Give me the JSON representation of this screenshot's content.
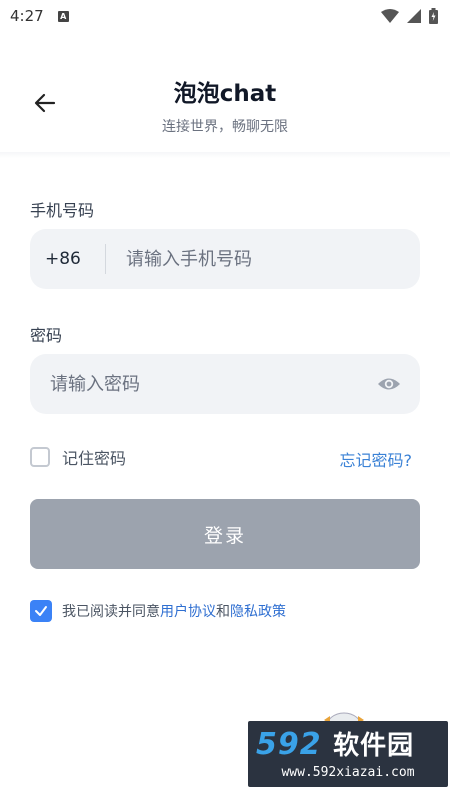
{
  "status_bar": {
    "time": "4:27",
    "notification_icon": "A"
  },
  "header": {
    "title": "泡泡chat",
    "subtitle": "连接世界，畅聊无限"
  },
  "phone": {
    "label": "手机号码",
    "country_code": "+86",
    "placeholder": "请输入手机号码",
    "value": ""
  },
  "password": {
    "label": "密码",
    "placeholder": "请输入密码",
    "value": ""
  },
  "remember": {
    "label": "记住密码",
    "checked": false
  },
  "forgot_label": "忘记密码?",
  "login_label": "登录",
  "agreement": {
    "checked": true,
    "prefix": "我已阅读并同意",
    "user_agreement": "用户协议",
    "and": "和",
    "privacy_policy": "隐私政策"
  },
  "watermark": {
    "number": "592",
    "chinese": "软件园",
    "url": "www.592xiazai.com"
  },
  "colors": {
    "accent": "#3b82f6",
    "link": "#2f6fd1",
    "button_disabled": "#9ca3ae",
    "field_bg": "#f1f3f6"
  }
}
